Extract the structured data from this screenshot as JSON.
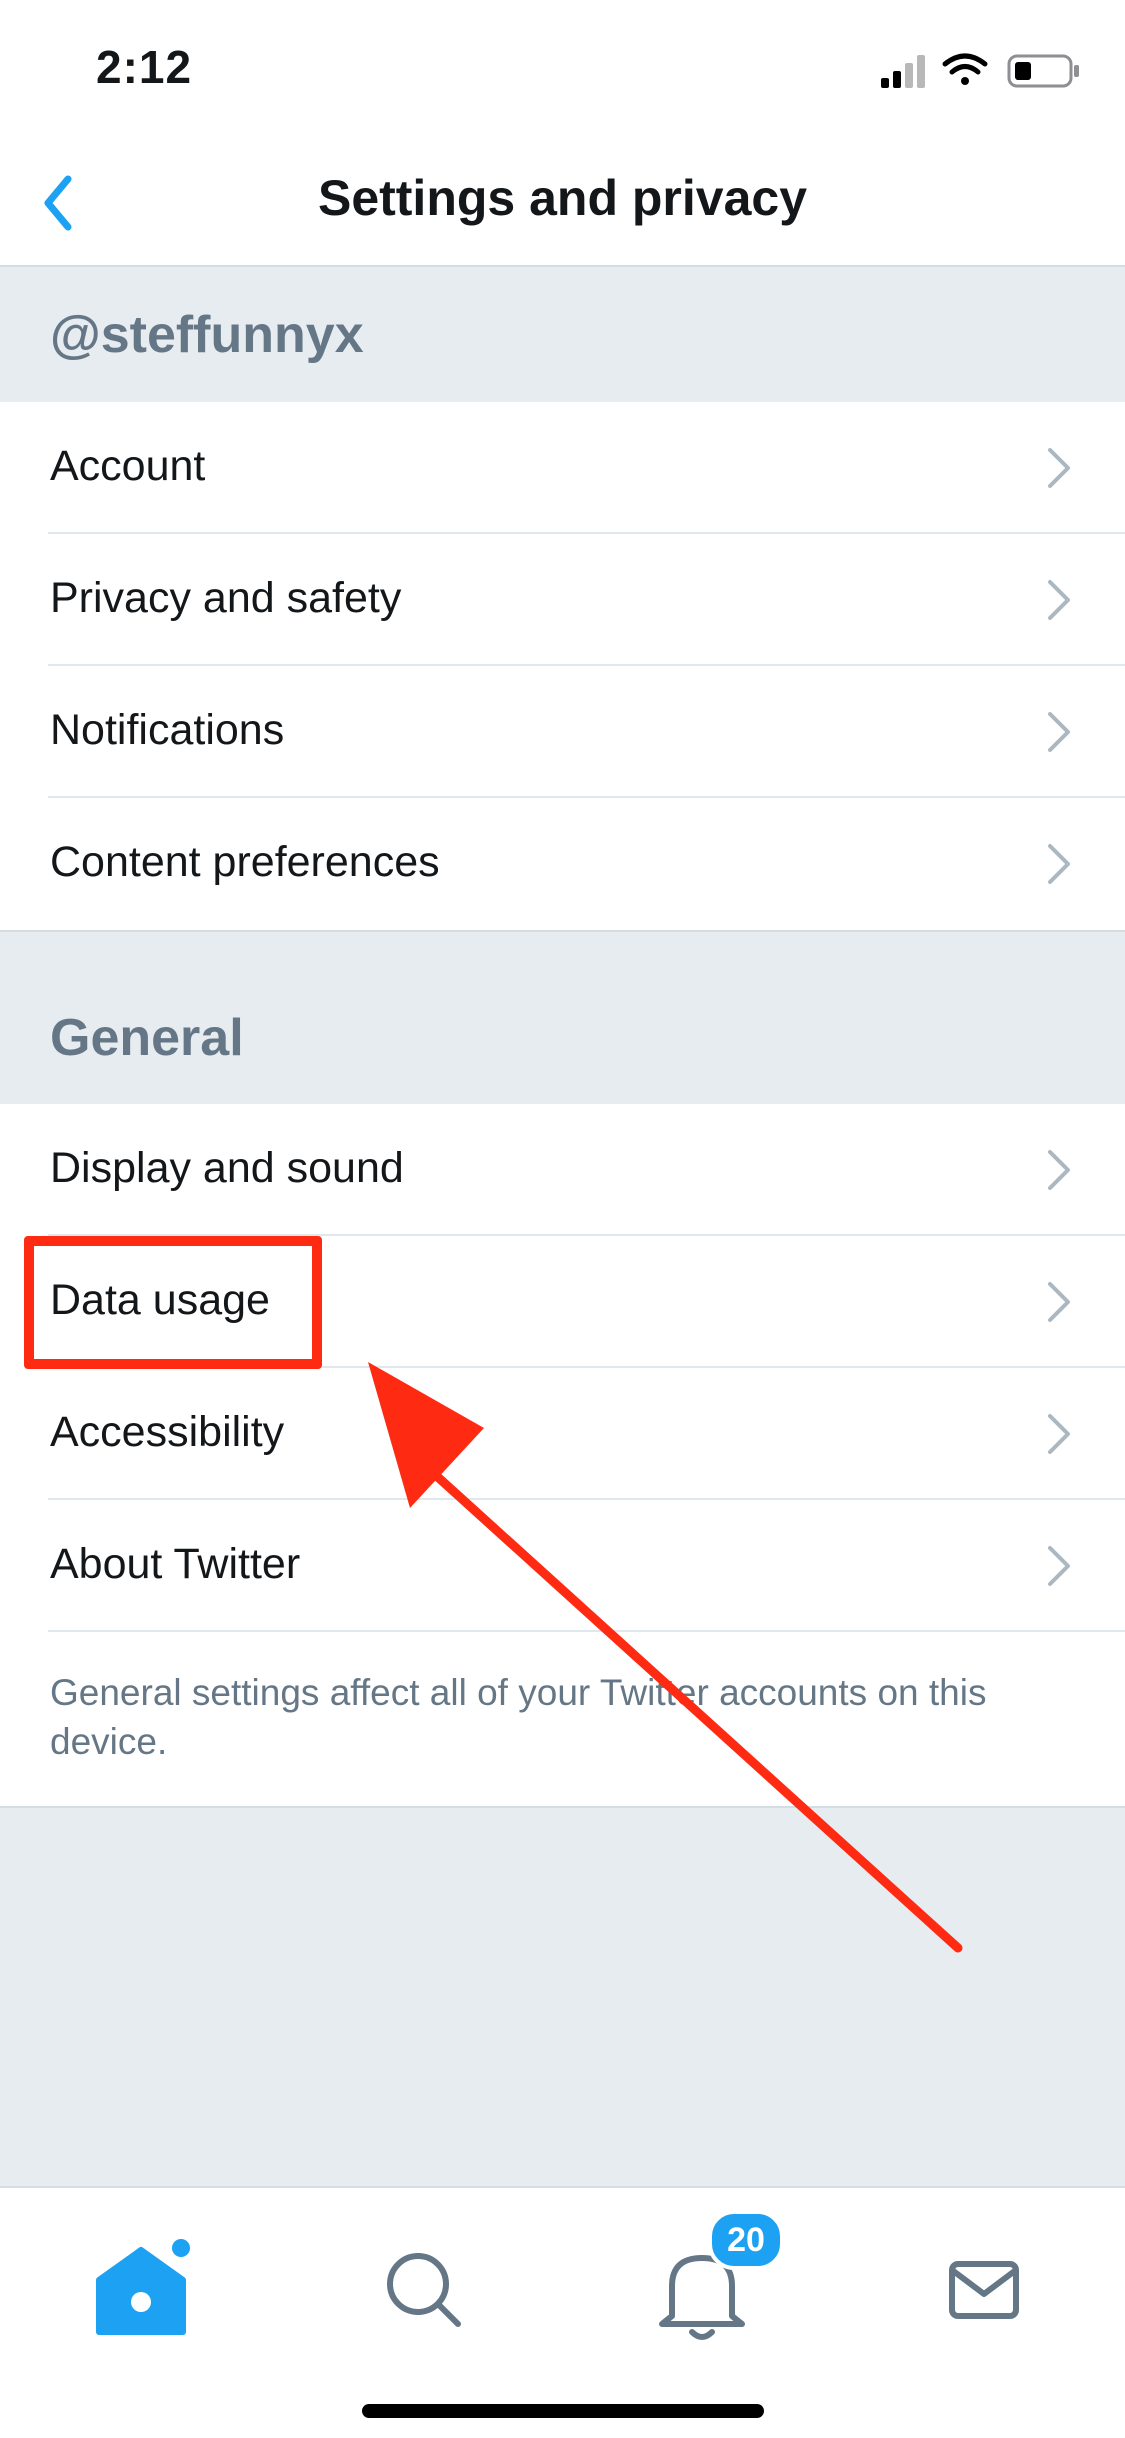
{
  "status_bar": {
    "time": "2:12",
    "icons": [
      "cellular-signal-icon",
      "wifi-icon",
      "battery-icon"
    ]
  },
  "nav": {
    "title": "Settings and privacy",
    "back_icon": "chevron-left-icon"
  },
  "sections": [
    {
      "header": "@steffunnyx",
      "items": [
        {
          "label": "Account"
        },
        {
          "label": "Privacy and safety"
        },
        {
          "label": "Notifications"
        },
        {
          "label": "Content preferences"
        }
      ]
    },
    {
      "header": "General",
      "items": [
        {
          "label": "Display and sound"
        },
        {
          "label": "Data usage"
        },
        {
          "label": "Accessibility"
        },
        {
          "label": "About Twitter"
        }
      ],
      "footnote": "General settings affect all of your Twitter accounts on this device."
    }
  ],
  "tab_bar": {
    "tabs": [
      {
        "name": "home",
        "icon": "home-icon",
        "active": true
      },
      {
        "name": "search",
        "icon": "search-icon",
        "active": false
      },
      {
        "name": "notifications",
        "icon": "bell-icon",
        "active": false
      },
      {
        "name": "messages",
        "icon": "envelope-icon",
        "active": false
      }
    ],
    "notifications_badge": "20"
  },
  "colors": {
    "accent": "#1DA1F2",
    "background": "#E6ECF0",
    "section_header_text": "#657786",
    "annotation": "#FF2A12"
  }
}
